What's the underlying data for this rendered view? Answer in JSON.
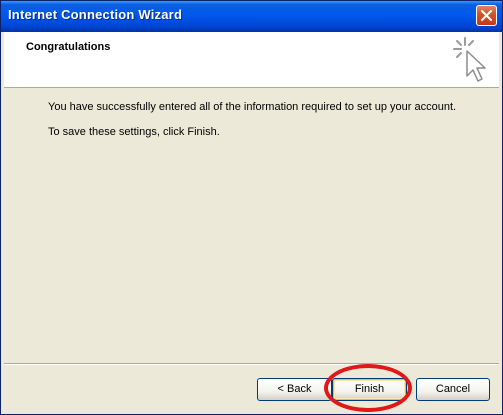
{
  "window": {
    "title": "Internet Connection Wizard",
    "close_icon": "close-icon"
  },
  "header": {
    "title": "Congratulations",
    "icon": "wizard-cursor-sparkle-icon"
  },
  "body": {
    "line1": "You have successfully entered all of the information required to set up your account.",
    "line2": "To save these settings, click Finish."
  },
  "buttons": {
    "back": "< Back",
    "finish": "Finish",
    "cancel": "Cancel"
  },
  "colors": {
    "titlebar": "#0058ee",
    "highlight": "#e01818",
    "face": "#ece9d8"
  }
}
